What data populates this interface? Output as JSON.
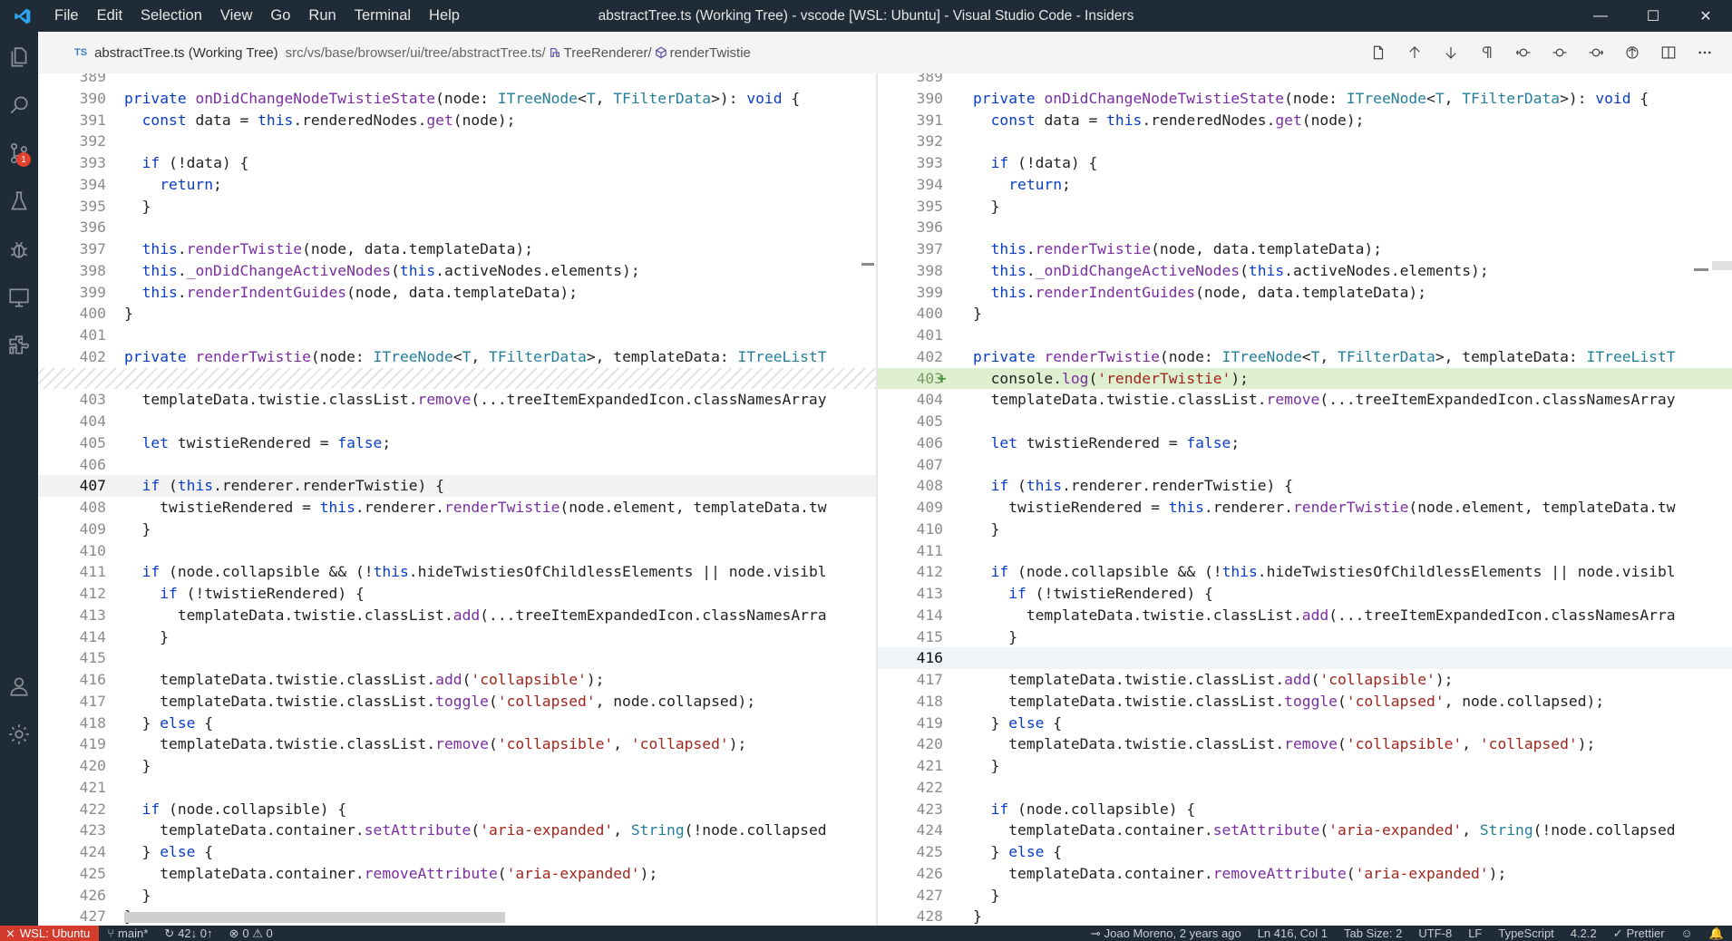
{
  "window": {
    "title": "abstractTree.ts (Working Tree) - vscode [WSL: Ubuntu] - Visual Studio Code - Insiders",
    "menu": [
      "File",
      "Edit",
      "Selection",
      "View",
      "Go",
      "Run",
      "Terminal",
      "Help"
    ],
    "controls": [
      "minimize-icon",
      "maximize-icon",
      "close-icon"
    ]
  },
  "activitybar": {
    "items": [
      "explorer-icon",
      "search-icon",
      "source-control-icon",
      "testing-icon",
      "run-debug-icon",
      "remote-explorer-icon",
      "extensions-icon"
    ],
    "scm_badge": "1",
    "bottom": [
      "accounts-icon",
      "manage-gear-icon"
    ]
  },
  "breadcrumb": {
    "lang_badge": "TS",
    "file": "abstractTree.ts (Working Tree)",
    "path": "src/vs/base/browser/ui/tree/abstractTree.ts/",
    "class": "TreeRenderer/",
    "method": "renderTwistie"
  },
  "toolbar": {
    "icons": [
      "open-file-icon",
      "previous-change-icon",
      "next-change-icon",
      "toggle-whitespace-icon",
      "revert-icon",
      "stage-icon",
      "unstage-icon",
      "open-changes-icon",
      "split-editor-icon",
      "more-actions-icon"
    ]
  },
  "colors": {
    "titlebar": "#1f2b36",
    "remote": "#d33b2c",
    "added_line": "#dff0d1",
    "keyword": "#0b3ec7",
    "string": "#a0261d"
  },
  "left_editor": {
    "lines": [
      {
        "n": "389",
        "code": ""
      },
      {
        "n": "390",
        "code": "private onDidChangeNodeTwistieState(node: ITreeNode<T, TFilterData>): void {"
      },
      {
        "n": "391",
        "code": "  const data = this.renderedNodes.get(node);"
      },
      {
        "n": "392",
        "code": ""
      },
      {
        "n": "393",
        "code": "  if (!data) {"
      },
      {
        "n": "394",
        "code": "    return;"
      },
      {
        "n": "395",
        "code": "  }"
      },
      {
        "n": "396",
        "code": ""
      },
      {
        "n": "397",
        "code": "  this.renderTwistie(node, data.templateData);"
      },
      {
        "n": "398",
        "code": "  this._onDidChangeActiveNodes(this.activeNodes.elements);"
      },
      {
        "n": "399",
        "code": "  this.renderIndentGuides(node, data.templateData);"
      },
      {
        "n": "400",
        "code": "}"
      },
      {
        "n": "401",
        "code": ""
      },
      {
        "n": "402",
        "code": "private renderTwistie(node: ITreeNode<T, TFilterData>, templateData: ITreeListT"
      },
      {
        "n": "",
        "code": "",
        "hatch": true
      },
      {
        "n": "403",
        "code": "  templateData.twistie.classList.remove(...treeItemExpandedIcon.classNamesArray"
      },
      {
        "n": "404",
        "code": ""
      },
      {
        "n": "405",
        "code": "  let twistieRendered = false;"
      },
      {
        "n": "406",
        "code": ""
      },
      {
        "n": "407",
        "code": "  if (this.renderer.renderTwistie) {",
        "current": true
      },
      {
        "n": "408",
        "code": "    twistieRendered = this.renderer.renderTwistie(node.element, templateData.tw"
      },
      {
        "n": "409",
        "code": "  }"
      },
      {
        "n": "410",
        "code": ""
      },
      {
        "n": "411",
        "code": "  if (node.collapsible && (!this.hideTwistiesOfChildlessElements || node.visibl"
      },
      {
        "n": "412",
        "code": "    if (!twistieRendered) {"
      },
      {
        "n": "413",
        "code": "      templateData.twistie.classList.add(...treeItemExpandedIcon.classNamesArra"
      },
      {
        "n": "414",
        "code": "    }"
      },
      {
        "n": "415",
        "code": ""
      },
      {
        "n": "416",
        "code": "    templateData.twistie.classList.add('collapsible');"
      },
      {
        "n": "417",
        "code": "    templateData.twistie.classList.toggle('collapsed', node.collapsed);"
      },
      {
        "n": "418",
        "code": "  } else {"
      },
      {
        "n": "419",
        "code": "    templateData.twistie.classList.remove('collapsible', 'collapsed');"
      },
      {
        "n": "420",
        "code": "  }"
      },
      {
        "n": "421",
        "code": ""
      },
      {
        "n": "422",
        "code": "  if (node.collapsible) {"
      },
      {
        "n": "423",
        "code": "    templateData.container.setAttribute('aria-expanded', String(!node.collapsed"
      },
      {
        "n": "424",
        "code": "  } else {"
      },
      {
        "n": "425",
        "code": "    templateData.container.removeAttribute('aria-expanded');"
      },
      {
        "n": "426",
        "code": "  }"
      },
      {
        "n": "427",
        "code": "}"
      }
    ]
  },
  "right_editor": {
    "lines": [
      {
        "n": "389",
        "code": ""
      },
      {
        "n": "390",
        "code": "private onDidChangeNodeTwistieState(node: ITreeNode<T, TFilterData>): void {"
      },
      {
        "n": "391",
        "code": "  const data = this.renderedNodes.get(node);"
      },
      {
        "n": "392",
        "code": ""
      },
      {
        "n": "393",
        "code": "  if (!data) {"
      },
      {
        "n": "394",
        "code": "    return;"
      },
      {
        "n": "395",
        "code": "  }"
      },
      {
        "n": "396",
        "code": ""
      },
      {
        "n": "397",
        "code": "  this.renderTwistie(node, data.templateData);"
      },
      {
        "n": "398",
        "code": "  this._onDidChangeActiveNodes(this.activeNodes.elements);"
      },
      {
        "n": "399",
        "code": "  this.renderIndentGuides(node, data.templateData);"
      },
      {
        "n": "400",
        "code": "}"
      },
      {
        "n": "401",
        "code": ""
      },
      {
        "n": "402",
        "code": "private renderTwistie(node: ITreeNode<T, TFilterData>, templateData: ITreeListT"
      },
      {
        "n": "403",
        "code": "  console.log('renderTwistie');",
        "added": true
      },
      {
        "n": "404",
        "code": "  templateData.twistie.classList.remove(...treeItemExpandedIcon.classNamesArray"
      },
      {
        "n": "405",
        "code": ""
      },
      {
        "n": "406",
        "code": "  let twistieRendered = false;"
      },
      {
        "n": "407",
        "code": ""
      },
      {
        "n": "408",
        "code": "  if (this.renderer.renderTwistie) {"
      },
      {
        "n": "409",
        "code": "    twistieRendered = this.renderer.renderTwistie(node.element, templateData.tw"
      },
      {
        "n": "410",
        "code": "  }"
      },
      {
        "n": "411",
        "code": ""
      },
      {
        "n": "412",
        "code": "  if (node.collapsible && (!this.hideTwistiesOfChildlessElements || node.visibl"
      },
      {
        "n": "413",
        "code": "    if (!twistieRendered) {"
      },
      {
        "n": "414",
        "code": "      templateData.twistie.classList.add(...treeItemExpandedIcon.classNamesArra"
      },
      {
        "n": "415",
        "code": "    }"
      },
      {
        "n": "416",
        "code": "",
        "current": true
      },
      {
        "n": "417",
        "code": "    templateData.twistie.classList.add('collapsible');"
      },
      {
        "n": "418",
        "code": "    templateData.twistie.classList.toggle('collapsed', node.collapsed);"
      },
      {
        "n": "419",
        "code": "  } else {"
      },
      {
        "n": "420",
        "code": "    templateData.twistie.classList.remove('collapsible', 'collapsed');"
      },
      {
        "n": "421",
        "code": "  }"
      },
      {
        "n": "422",
        "code": ""
      },
      {
        "n": "423",
        "code": "  if (node.collapsible) {"
      },
      {
        "n": "424",
        "code": "    templateData.container.setAttribute('aria-expanded', String(!node.collapsed"
      },
      {
        "n": "425",
        "code": "  } else {"
      },
      {
        "n": "426",
        "code": "    templateData.container.removeAttribute('aria-expanded');"
      },
      {
        "n": "427",
        "code": "  }"
      },
      {
        "n": "428",
        "code": "}"
      }
    ]
  },
  "statusbar": {
    "remote": "WSL: Ubuntu",
    "branch": "main*",
    "sync": "42↓ 0↑",
    "problems": "0 ⚠ 0",
    "blame": "Joao Moreno, 2 years ago",
    "position": "Ln 416, Col 1",
    "tab_size": "Tab Size: 2",
    "encoding": "UTF-8",
    "eol": "LF",
    "language": "TypeScript",
    "ts_version": "4.2.2",
    "formatter": "Prettier"
  }
}
